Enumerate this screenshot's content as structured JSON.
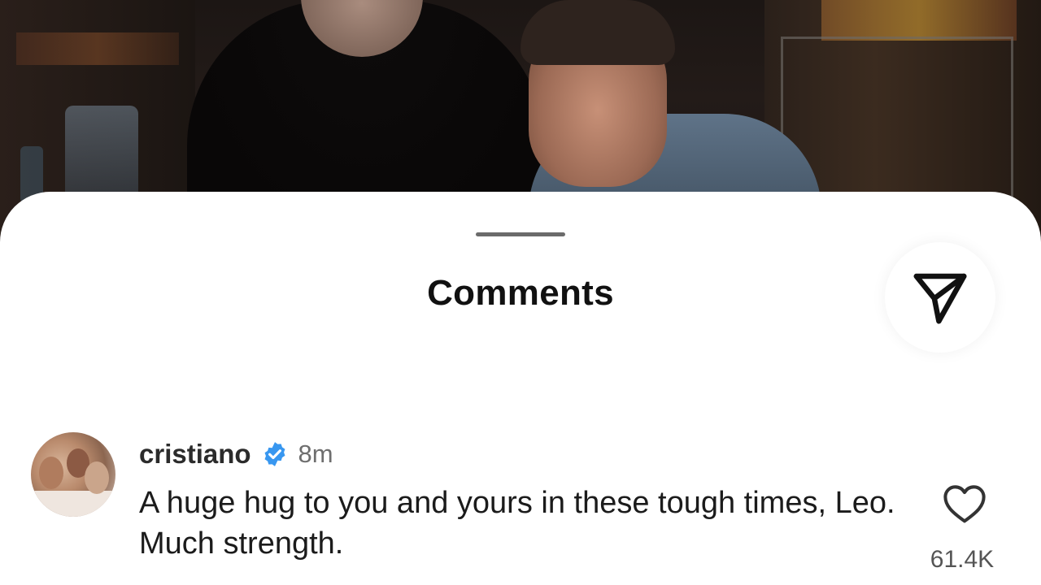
{
  "sheet": {
    "title": "Comments"
  },
  "icons": {
    "share": "paper-plane-icon",
    "verified": "verified-badge-icon",
    "like": "heart-outline-icon"
  },
  "colors": {
    "verified_blue": "#3897f0",
    "text_primary": "#111111",
    "text_secondary": "#6e6e6e"
  },
  "comment": {
    "username": "cristiano",
    "timestamp": "8m",
    "text": "A huge hug to you and yours in these tough times, Leo. Much strength.",
    "like_count": "61.4K"
  }
}
